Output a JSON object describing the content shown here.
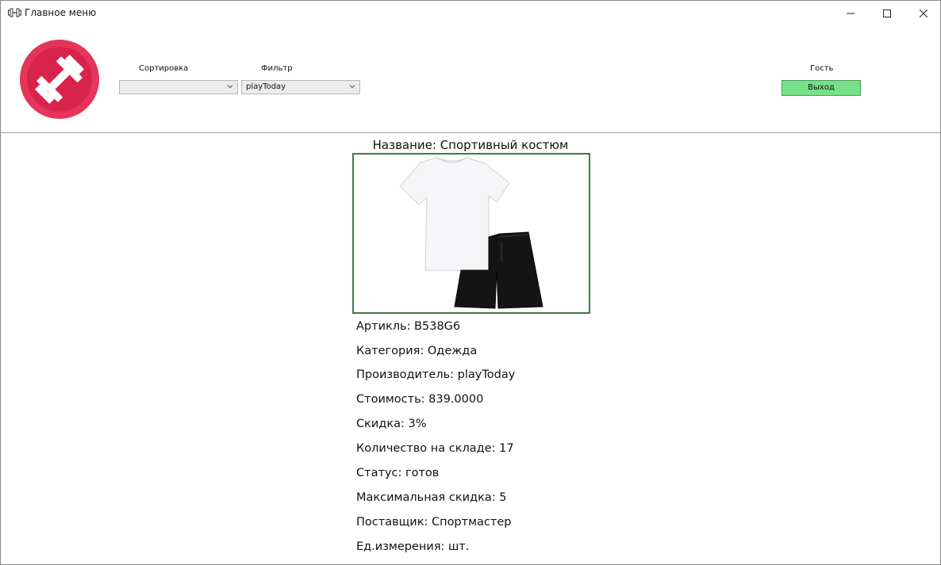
{
  "window": {
    "title": "Главное меню"
  },
  "header": {
    "sort_label": "Сортировка",
    "sort_value": "",
    "filter_label": "Фильтр",
    "filter_value": "playToday",
    "user_label": "Гость",
    "exit_label": "Выход",
    "exit_color": "#77e08a",
    "logo_color": "#e23a5a",
    "logo_icon": "dumbbell-icon"
  },
  "product": {
    "name": "Название: Спортивный костюм",
    "image_icon": "tshirt-shorts-image",
    "fields": [
      "Артикль: B538G6",
      "Категория: Одежда",
      "Производитель: playToday",
      "Стоимость: 839.0000",
      "Скидка: 3%",
      "Количество на складе: 17",
      "Статус: готов",
      "Максимальная скидка: 5",
      "Поставщик: Спортмастер",
      "Ед.измерения: шт."
    ]
  }
}
